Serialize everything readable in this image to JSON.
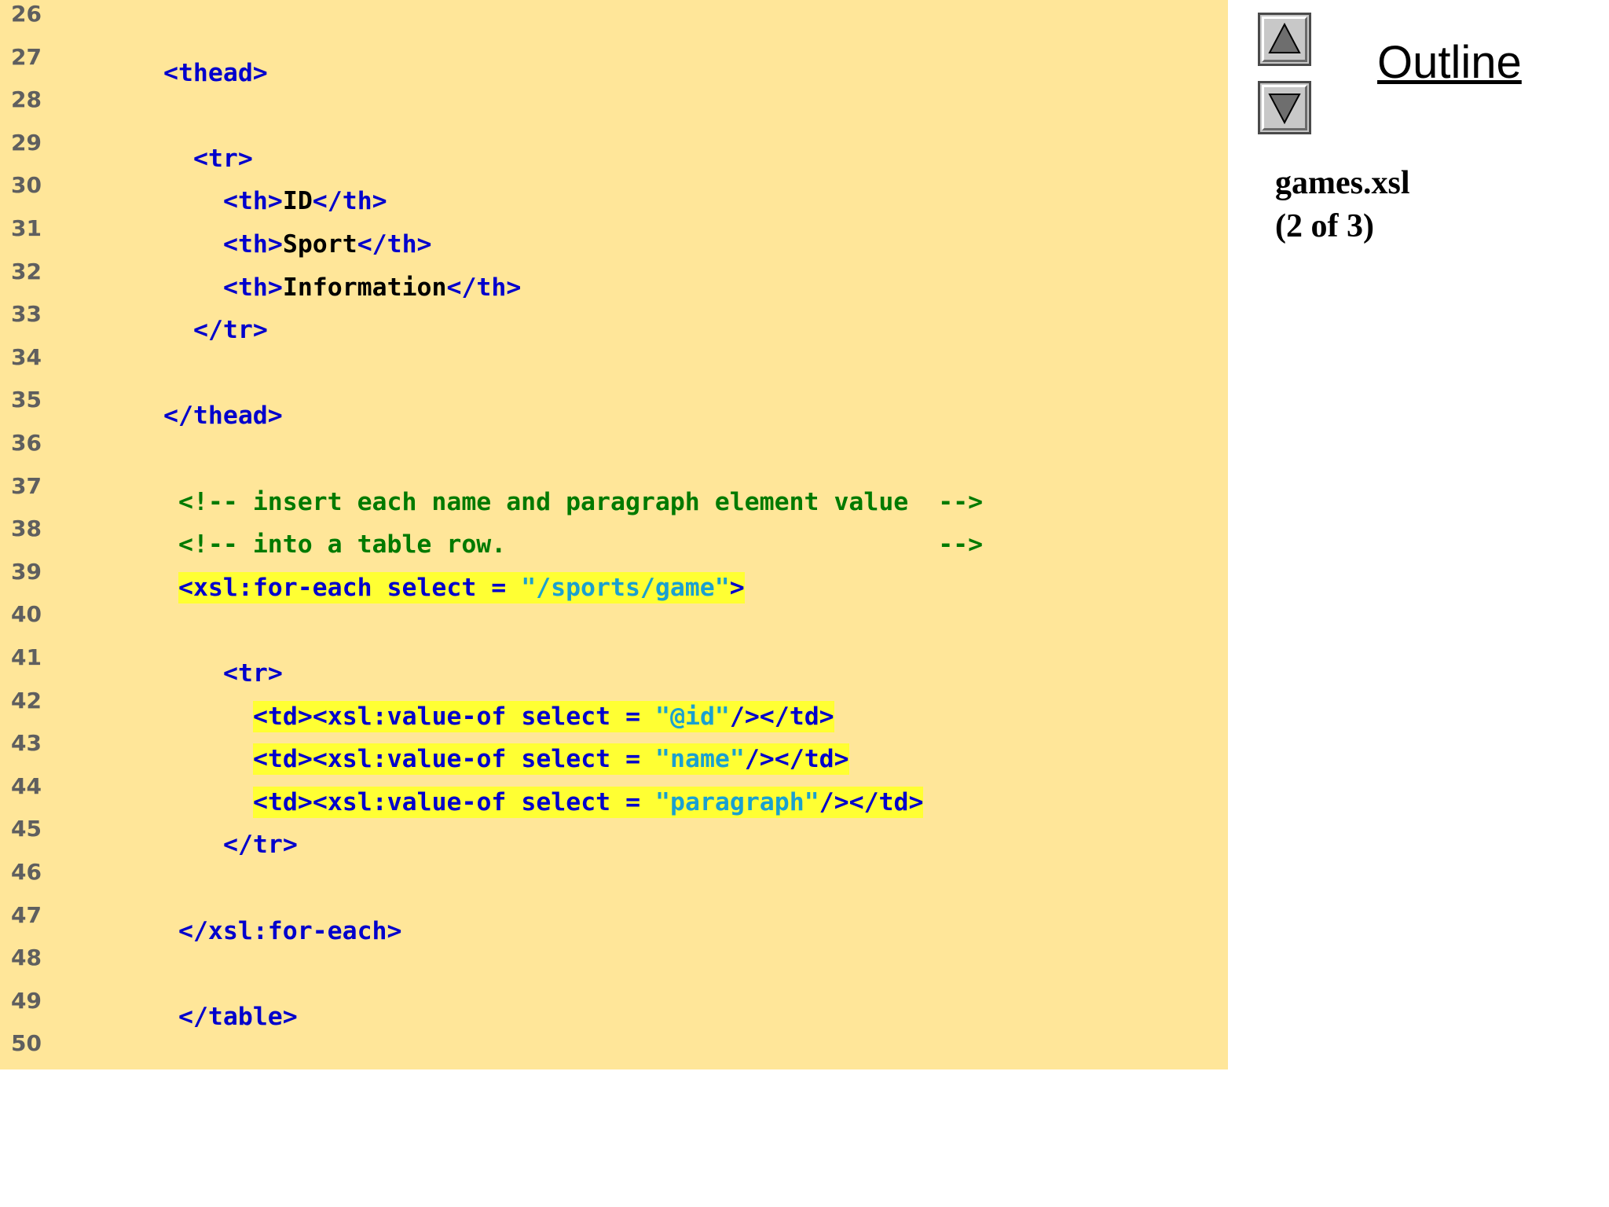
{
  "sidebar": {
    "outline_title": "Outline",
    "file_name": "games.xsl",
    "page_indicator": "(2 of 3)",
    "nav_up_icon": "triangle-up-icon",
    "nav_down_icon": "triangle-down-icon"
  },
  "code": {
    "line_numbers": [
      "26",
      "27",
      "28",
      "29",
      "30",
      "31",
      "32",
      "33",
      "34",
      "35",
      "36",
      "37",
      "38",
      "39",
      "40",
      "41",
      "42",
      "43",
      "44",
      "45",
      "46",
      "47",
      "48",
      "49",
      "50"
    ],
    "lines": [
      {
        "n": "26",
        "segments": []
      },
      {
        "n": "27",
        "segments": [
          {
            "t": "tag",
            "s": "<thead>"
          }
        ]
      },
      {
        "n": "28",
        "segments": []
      },
      {
        "n": "29",
        "segments": [
          {
            "t": "tag",
            "s": "<tr>"
          }
        ]
      },
      {
        "n": "30",
        "segments": [
          {
            "t": "tag",
            "s": "<th>"
          },
          {
            "t": "txt",
            "s": "ID"
          },
          {
            "t": "tag",
            "s": "</th>"
          }
        ]
      },
      {
        "n": "31",
        "segments": [
          {
            "t": "tag",
            "s": "<th>"
          },
          {
            "t": "txt",
            "s": "Sport"
          },
          {
            "t": "tag",
            "s": "</th>"
          }
        ]
      },
      {
        "n": "32",
        "segments": [
          {
            "t": "tag",
            "s": "<th>"
          },
          {
            "t": "txt",
            "s": "Information"
          },
          {
            "t": "tag",
            "s": "</th>"
          }
        ]
      },
      {
        "n": "33",
        "segments": [
          {
            "t": "tag",
            "s": "</tr>"
          }
        ]
      },
      {
        "n": "34",
        "segments": []
      },
      {
        "n": "35",
        "segments": [
          {
            "t": "tag",
            "s": "</thead>"
          }
        ]
      },
      {
        "n": "36",
        "segments": []
      },
      {
        "n": "37",
        "segments": [
          {
            "t": "cmt",
            "s": "<!-- insert each name and paragraph element value  -->"
          }
        ]
      },
      {
        "n": "38",
        "segments": [
          {
            "t": "cmt",
            "s": "<!-- into a table row.                             -->"
          }
        ]
      },
      {
        "n": "39",
        "highlight": true,
        "segments": [
          {
            "t": "tag",
            "s": "<xsl:for-each select = "
          },
          {
            "t": "str",
            "s": "\"/sports/game\""
          },
          {
            "t": "tag",
            "s": ">"
          }
        ]
      },
      {
        "n": "40",
        "segments": []
      },
      {
        "n": "41",
        "segments": [
          {
            "t": "tag",
            "s": "<tr>"
          }
        ]
      },
      {
        "n": "42",
        "highlight": true,
        "segments": [
          {
            "t": "tag",
            "s": "<td><xsl:value-of select = "
          },
          {
            "t": "str",
            "s": "\"@id\""
          },
          {
            "t": "tag",
            "s": "/></td>"
          }
        ]
      },
      {
        "n": "43",
        "highlight": true,
        "segments": [
          {
            "t": "tag",
            "s": "<td><xsl:value-of select = "
          },
          {
            "t": "str",
            "s": "\"name\""
          },
          {
            "t": "tag",
            "s": "/></td>"
          }
        ]
      },
      {
        "n": "44",
        "highlight": true,
        "segments": [
          {
            "t": "tag",
            "s": "<td><xsl:value-of select = "
          },
          {
            "t": "str",
            "s": "\"paragraph\""
          },
          {
            "t": "tag",
            "s": "/></td>"
          }
        ]
      },
      {
        "n": "45",
        "segments": [
          {
            "t": "tag",
            "s": "</tr>"
          }
        ]
      },
      {
        "n": "46",
        "segments": []
      },
      {
        "n": "47",
        "segments": [
          {
            "t": "tag",
            "s": "</xsl:for-each>"
          }
        ]
      },
      {
        "n": "48",
        "segments": []
      },
      {
        "n": "49",
        "segments": [
          {
            "t": "tag",
            "s": "</table>"
          }
        ]
      },
      {
        "n": "50",
        "segments": []
      }
    ]
  },
  "colors": {
    "panel_background": "#ffe699",
    "tag": "#0000cc",
    "text": "#000000",
    "comment": "#007a00",
    "string": "#1aa0d0",
    "highlight": "#ffff33",
    "line_number": "#5f5f5f"
  }
}
